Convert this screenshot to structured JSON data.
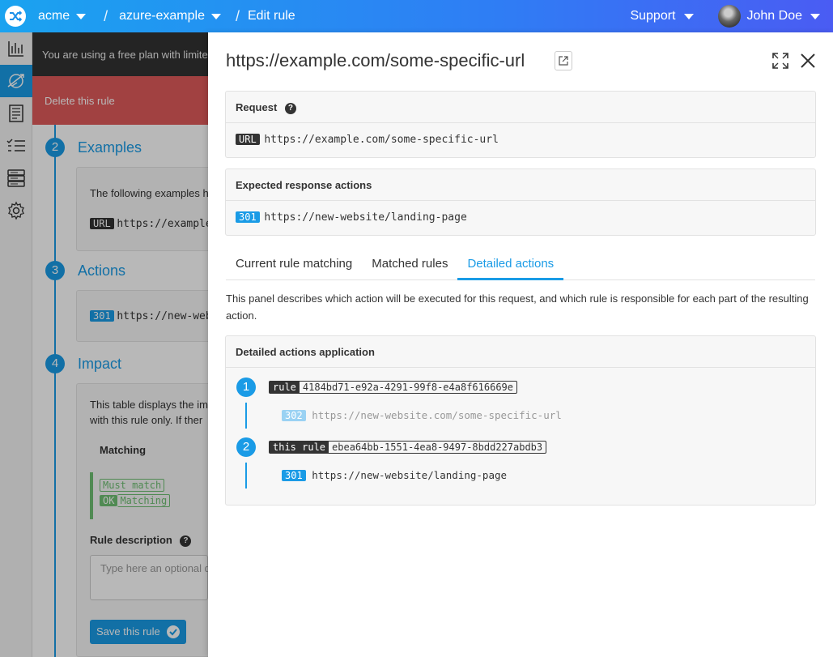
{
  "topbar": {
    "org": "acme",
    "project": "azure-example",
    "page": "Edit rule",
    "support": "Support",
    "user": "John Doe"
  },
  "background": {
    "notice": "You are using a free plan with limited features",
    "delete_label": "Delete this rule",
    "steps": [
      {
        "number": "2",
        "title": "Examples"
      },
      {
        "number": "3",
        "title": "Actions"
      },
      {
        "number": "4",
        "title": "Impact"
      }
    ],
    "examples_text": "The following examples h",
    "example_tag": "URL",
    "example_url": "https://example",
    "actions_tag": "301",
    "actions_url": "https://new-webs",
    "impact_text_1": "This table displays the im",
    "impact_text_2": "with this rule only. If ther",
    "matching_header": "Matching",
    "must_match": "Must match",
    "ok_tag": "OK",
    "matching_label": "Matching",
    "rule_description": "Rule description",
    "description_placeholder": "Type here an optional d",
    "save_label": "Save this rule"
  },
  "panel": {
    "title": "https://example.com/some-specific-url",
    "request": {
      "heading": "Request",
      "tag": "URL",
      "url": "https://example.com/some-specific-url"
    },
    "expected": {
      "heading": "Expected response actions",
      "code": "301",
      "url": "https://new-website/landing-page"
    },
    "tabs": [
      {
        "label": "Current rule matching"
      },
      {
        "label": "Matched rules"
      },
      {
        "label": "Detailed actions"
      }
    ],
    "description": "This panel describes which action will be executed for this request, and which rule is responsible for each part of the resulting action.",
    "detailed": {
      "heading": "Detailed actions application",
      "items": [
        {
          "number": "1",
          "rule_key": "rule",
          "rule_id": "4184bd71-e92a-4291-99f8-e4a8f616669e",
          "code": "302",
          "url": "https://new-website.com/some-specific-url"
        },
        {
          "number": "2",
          "rule_key": "this rule",
          "rule_id": "ebea64bb-1551-4ea8-9497-8bdd227abdb3",
          "code": "301",
          "url": "https://new-website/landing-page"
        }
      ]
    }
  },
  "colors": {
    "accent": "#1a9be6",
    "danger": "#e05a5a",
    "success": "#6fbf73"
  }
}
